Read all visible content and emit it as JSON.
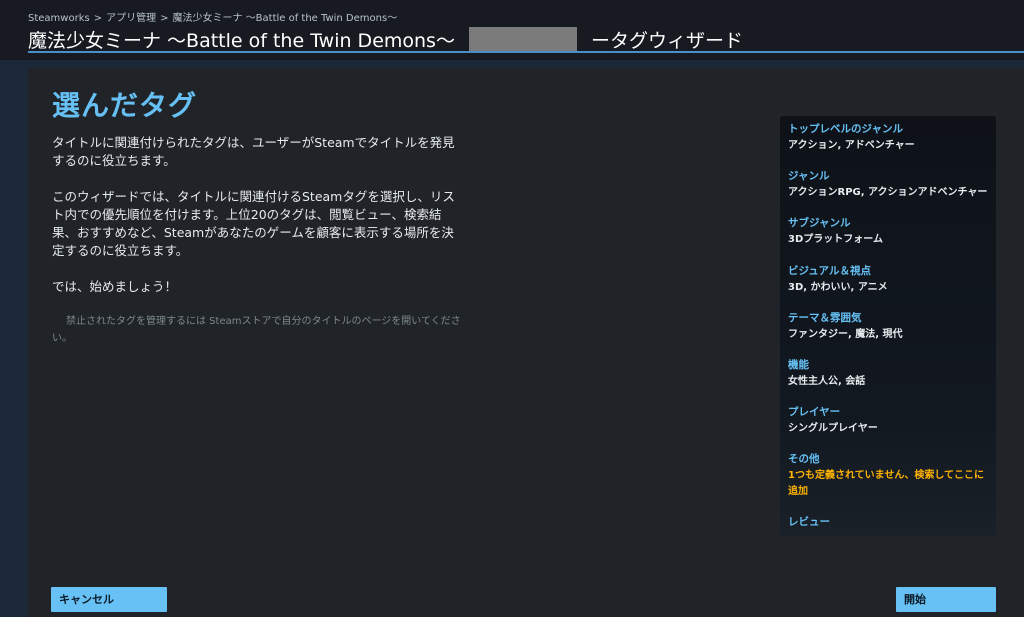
{
  "breadcrumb": {
    "items": [
      "Steamworks",
      "アプリ管理",
      "魔法少女ミーナ 〜Battle of the Twin Demons〜"
    ],
    "separator": ">"
  },
  "header": {
    "title": "魔法少女ミーナ 〜Battle of the Twin Demons〜",
    "title_suffix": "ータグウィザード"
  },
  "main": {
    "heading": "選んだタグ",
    "paragraphs": [
      "タイトルに関連付けられたタグは、ユーザーがSteamでタイトルを発見するのに役立ちます。",
      "このウィザードでは、タイトルに関連付けるSteamタグを選択し、リスト内での優先順位を付けます。上位20のタグは、閲覧ビュー、検索結果、おすすめなど、Steamがあなたのゲームを顧客に表示する場所を決定するのに役立ちます。",
      "では、始めましょう！"
    ],
    "note": "禁止されたタグを管理するには Steamストアで自分のタイトルのページを開いてください。"
  },
  "sidebar": {
    "items": [
      {
        "label": "トップレベルのジャンル",
        "value": "アクション, アドベンチャー"
      },
      {
        "label": "ジャンル",
        "value": "アクションRPG, アクションアドベンチャー"
      },
      {
        "label": "サブジャンル",
        "value": "3Dプラットフォーム"
      },
      {
        "label": "ビジュアル＆視点",
        "value": "3D, かわいい, アニメ"
      },
      {
        "label": "テーマ＆雰囲気",
        "value": "ファンタジー, 魔法, 現代"
      },
      {
        "label": "機能",
        "value": "女性主人公, 会話"
      },
      {
        "label": "プレイヤー",
        "value": "シングルプレイヤー"
      },
      {
        "label": "その他",
        "warning": "1つも定義されていません、検索してここに追加"
      },
      {
        "label": "レビュー"
      }
    ]
  },
  "buttons": {
    "cancel": "キャンセル",
    "start": "開始"
  },
  "colors": {
    "accent": "#66c0f4",
    "warning": "#ffb400",
    "button": "#67c1f5"
  }
}
